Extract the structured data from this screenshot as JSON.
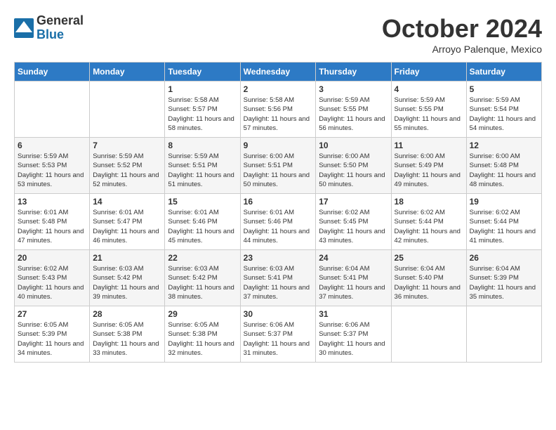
{
  "logo": {
    "general": "General",
    "blue": "Blue"
  },
  "title": "October 2024",
  "location": "Arroyo Palenque, Mexico",
  "days_header": [
    "Sunday",
    "Monday",
    "Tuesday",
    "Wednesday",
    "Thursday",
    "Friday",
    "Saturday"
  ],
  "weeks": [
    [
      {
        "day": "",
        "info": ""
      },
      {
        "day": "",
        "info": ""
      },
      {
        "day": "1",
        "info": "Sunrise: 5:58 AM\nSunset: 5:57 PM\nDaylight: 11 hours and 58 minutes."
      },
      {
        "day": "2",
        "info": "Sunrise: 5:58 AM\nSunset: 5:56 PM\nDaylight: 11 hours and 57 minutes."
      },
      {
        "day": "3",
        "info": "Sunrise: 5:59 AM\nSunset: 5:55 PM\nDaylight: 11 hours and 56 minutes."
      },
      {
        "day": "4",
        "info": "Sunrise: 5:59 AM\nSunset: 5:55 PM\nDaylight: 11 hours and 55 minutes."
      },
      {
        "day": "5",
        "info": "Sunrise: 5:59 AM\nSunset: 5:54 PM\nDaylight: 11 hours and 54 minutes."
      }
    ],
    [
      {
        "day": "6",
        "info": "Sunrise: 5:59 AM\nSunset: 5:53 PM\nDaylight: 11 hours and 53 minutes."
      },
      {
        "day": "7",
        "info": "Sunrise: 5:59 AM\nSunset: 5:52 PM\nDaylight: 11 hours and 52 minutes."
      },
      {
        "day": "8",
        "info": "Sunrise: 5:59 AM\nSunset: 5:51 PM\nDaylight: 11 hours and 51 minutes."
      },
      {
        "day": "9",
        "info": "Sunrise: 6:00 AM\nSunset: 5:51 PM\nDaylight: 11 hours and 50 minutes."
      },
      {
        "day": "10",
        "info": "Sunrise: 6:00 AM\nSunset: 5:50 PM\nDaylight: 11 hours and 50 minutes."
      },
      {
        "day": "11",
        "info": "Sunrise: 6:00 AM\nSunset: 5:49 PM\nDaylight: 11 hours and 49 minutes."
      },
      {
        "day": "12",
        "info": "Sunrise: 6:00 AM\nSunset: 5:48 PM\nDaylight: 11 hours and 48 minutes."
      }
    ],
    [
      {
        "day": "13",
        "info": "Sunrise: 6:01 AM\nSunset: 5:48 PM\nDaylight: 11 hours and 47 minutes."
      },
      {
        "day": "14",
        "info": "Sunrise: 6:01 AM\nSunset: 5:47 PM\nDaylight: 11 hours and 46 minutes."
      },
      {
        "day": "15",
        "info": "Sunrise: 6:01 AM\nSunset: 5:46 PM\nDaylight: 11 hours and 45 minutes."
      },
      {
        "day": "16",
        "info": "Sunrise: 6:01 AM\nSunset: 5:46 PM\nDaylight: 11 hours and 44 minutes."
      },
      {
        "day": "17",
        "info": "Sunrise: 6:02 AM\nSunset: 5:45 PM\nDaylight: 11 hours and 43 minutes."
      },
      {
        "day": "18",
        "info": "Sunrise: 6:02 AM\nSunset: 5:44 PM\nDaylight: 11 hours and 42 minutes."
      },
      {
        "day": "19",
        "info": "Sunrise: 6:02 AM\nSunset: 5:44 PM\nDaylight: 11 hours and 41 minutes."
      }
    ],
    [
      {
        "day": "20",
        "info": "Sunrise: 6:02 AM\nSunset: 5:43 PM\nDaylight: 11 hours and 40 minutes."
      },
      {
        "day": "21",
        "info": "Sunrise: 6:03 AM\nSunset: 5:42 PM\nDaylight: 11 hours and 39 minutes."
      },
      {
        "day": "22",
        "info": "Sunrise: 6:03 AM\nSunset: 5:42 PM\nDaylight: 11 hours and 38 minutes."
      },
      {
        "day": "23",
        "info": "Sunrise: 6:03 AM\nSunset: 5:41 PM\nDaylight: 11 hours and 37 minutes."
      },
      {
        "day": "24",
        "info": "Sunrise: 6:04 AM\nSunset: 5:41 PM\nDaylight: 11 hours and 37 minutes."
      },
      {
        "day": "25",
        "info": "Sunrise: 6:04 AM\nSunset: 5:40 PM\nDaylight: 11 hours and 36 minutes."
      },
      {
        "day": "26",
        "info": "Sunrise: 6:04 AM\nSunset: 5:39 PM\nDaylight: 11 hours and 35 minutes."
      }
    ],
    [
      {
        "day": "27",
        "info": "Sunrise: 6:05 AM\nSunset: 5:39 PM\nDaylight: 11 hours and 34 minutes."
      },
      {
        "day": "28",
        "info": "Sunrise: 6:05 AM\nSunset: 5:38 PM\nDaylight: 11 hours and 33 minutes."
      },
      {
        "day": "29",
        "info": "Sunrise: 6:05 AM\nSunset: 5:38 PM\nDaylight: 11 hours and 32 minutes."
      },
      {
        "day": "30",
        "info": "Sunrise: 6:06 AM\nSunset: 5:37 PM\nDaylight: 11 hours and 31 minutes."
      },
      {
        "day": "31",
        "info": "Sunrise: 6:06 AM\nSunset: 5:37 PM\nDaylight: 11 hours and 30 minutes."
      },
      {
        "day": "",
        "info": ""
      },
      {
        "day": "",
        "info": ""
      }
    ]
  ]
}
